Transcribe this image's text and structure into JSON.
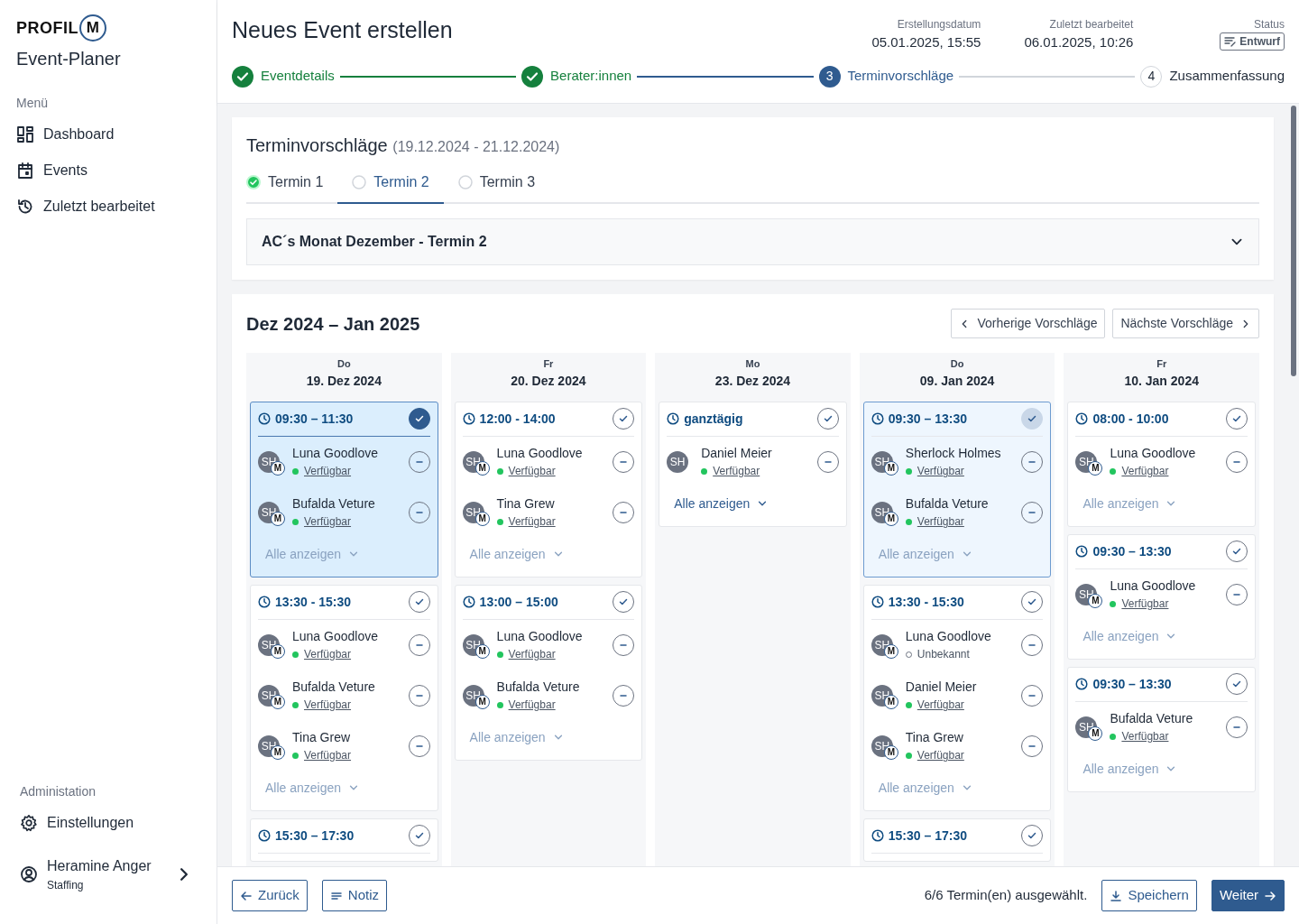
{
  "sidebar": {
    "logo": {
      "word": "PROFIL",
      "letter": "M"
    },
    "app_title": "Event-Planer",
    "menu_label": "Menü",
    "menu": [
      {
        "label": "Dashboard"
      },
      {
        "label": "Events"
      },
      {
        "label": "Zuletzt bearbeitet"
      }
    ],
    "admin_label": "Administation",
    "admin": [
      {
        "label": "Einstellungen"
      }
    ],
    "user": {
      "name": "Heramine Anger",
      "role": "Staffing"
    }
  },
  "header": {
    "title": "Neues Event erstellen",
    "meta": [
      {
        "label": "Erstellungsdatum",
        "value": "05.01.2025, 15:55"
      },
      {
        "label": "Zuletzt bearbeitet",
        "value": "06.01.2025, 10:26"
      }
    ],
    "status": {
      "label": "Status",
      "value": "Entwurf"
    },
    "steps": [
      {
        "label": "Eventdetails",
        "done": true,
        "selected": false
      },
      {
        "label": "Berater:innen",
        "done": true,
        "selected": false
      },
      {
        "number": "3",
        "label": "Terminvorschläge",
        "done": false,
        "selected": true
      },
      {
        "number": "4",
        "label": "Zusammenfassung",
        "done": false,
        "selected": false
      }
    ]
  },
  "proposals": {
    "title": "Terminvorschläge",
    "range": "(19.12.2024 - 21.12.2024)",
    "tabs": [
      {
        "label": "Termin 1",
        "done": true,
        "selected": false
      },
      {
        "label": "Termin 2",
        "done": false,
        "selected": true
      },
      {
        "label": "Termin 3",
        "done": false,
        "selected": false
      }
    ],
    "accordion": {
      "title": "AC´s Monat Dezember - Termin 2",
      "expanded": false
    }
  },
  "calendar": {
    "title": "Dez 2024 – Jan 2025",
    "prev_button": "Vorherige Vorschläge",
    "next_button": "Nächste Vorschläge",
    "days": [
      {
        "weekday": "Do",
        "date": "19. Dez 2024",
        "slots": [
          {
            "time": "09:30 – 11:30",
            "selected": true,
            "highlighted": false,
            "show_all": {
              "label": "Alle anzeigen",
              "enabled": false
            },
            "people": [
              {
                "initials": "SH",
                "badge": "M",
                "name": "Luna Goodlove",
                "status": "Verfügbar",
                "available": true
              },
              {
                "initials": "SH",
                "badge": "M",
                "name": "Bufalda Veture",
                "status": "Verfügbar",
                "available": true
              }
            ]
          },
          {
            "time": "13:30 - 15:30",
            "selected": false,
            "highlighted": false,
            "show_all": {
              "label": "Alle anzeigen",
              "enabled": false
            },
            "people": [
              {
                "initials": "SH",
                "badge": "M",
                "name": "Luna Goodlove",
                "status": "Verfügbar",
                "available": true
              },
              {
                "initials": "SH",
                "badge": "M",
                "name": "Bufalda Veture",
                "status": "Verfügbar",
                "available": true
              },
              {
                "initials": "SH",
                "badge": "M",
                "name": "Tina Grew",
                "status": "Verfügbar",
                "available": true
              }
            ]
          },
          {
            "time": "15:30 – 17:30",
            "selected": false,
            "highlighted": false
          }
        ]
      },
      {
        "weekday": "Fr",
        "date": "20. Dez 2024",
        "slots": [
          {
            "time": "12:00 - 14:00",
            "selected": false,
            "highlighted": false,
            "show_all": {
              "label": "Alle anzeigen",
              "enabled": false
            },
            "people": [
              {
                "initials": "SH",
                "badge": "M",
                "name": "Luna Goodlove",
                "status": "Verfügbar",
                "available": true
              },
              {
                "initials": "SH",
                "badge": "M",
                "name": "Tina Grew",
                "status": "Verfügbar",
                "available": true
              }
            ]
          },
          {
            "time": "13:00 – 15:00",
            "selected": false,
            "highlighted": false,
            "show_all": {
              "label": "Alle anzeigen",
              "enabled": false
            },
            "people": [
              {
                "initials": "SH",
                "badge": "M",
                "name": "Luna Goodlove",
                "status": "Verfügbar",
                "available": true
              },
              {
                "initials": "SH",
                "badge": "M",
                "name": "Bufalda Veture",
                "status": "Verfügbar",
                "available": true
              }
            ]
          }
        ]
      },
      {
        "weekday": "Mo",
        "date": "23. Dez 2024",
        "slots": [
          {
            "time": "ganztägig",
            "selected": false,
            "highlighted": false,
            "show_all": {
              "label": "Alle anzeigen",
              "enabled": true
            },
            "people": [
              {
                "initials": "SH",
                "name": "Daniel Meier",
                "status": "Verfügbar",
                "available": true
              }
            ]
          }
        ]
      },
      {
        "weekday": "Do",
        "date": "09. Jan 2024",
        "slots": [
          {
            "time": "09:30 – 13:30",
            "selected": false,
            "highlighted": true,
            "show_all": {
              "label": "Alle anzeigen",
              "enabled": false
            },
            "people": [
              {
                "initials": "SH",
                "badge": "M",
                "name": "Sherlock Holmes",
                "status": "Verfügbar",
                "available": true
              },
              {
                "initials": "SH",
                "badge": "M",
                "name": "Bufalda Veture",
                "status": "Verfügbar",
                "available": true
              }
            ]
          },
          {
            "time": "13:30 - 15:30",
            "selected": false,
            "highlighted": false,
            "show_all": {
              "label": "Alle anzeigen",
              "enabled": false
            },
            "people": [
              {
                "initials": "SH",
                "badge": "M",
                "name": "Luna Goodlove",
                "status": "Unbekannt",
                "available": false
              },
              {
                "initials": "SH",
                "badge": "M",
                "name": "Daniel Meier",
                "status": "Verfügbar",
                "available": true
              },
              {
                "initials": "SH",
                "badge": "M",
                "name": "Tina Grew",
                "status": "Verfügbar",
                "available": true
              }
            ]
          },
          {
            "time": "15:30 – 17:30",
            "selected": false,
            "highlighted": false
          }
        ]
      },
      {
        "weekday": "Fr",
        "date": "10. Jan 2024",
        "slots": [
          {
            "time": "08:00 - 10:00",
            "selected": false,
            "highlighted": false,
            "show_all": {
              "label": "Alle anzeigen",
              "enabled": false
            },
            "people": [
              {
                "initials": "SH",
                "badge": "M",
                "name": "Luna Goodlove",
                "status": "Verfügbar",
                "available": true
              }
            ]
          },
          {
            "time": "09:30 – 13:30",
            "selected": false,
            "highlighted": false,
            "show_all": {
              "label": "Alle anzeigen",
              "enabled": false
            },
            "people": [
              {
                "initials": "SH",
                "badge": "M",
                "name": "Luna Goodlove",
                "status": "Verfügbar",
                "available": true
              }
            ]
          },
          {
            "time": "09:30 – 13:30",
            "selected": false,
            "highlighted": false,
            "show_all": {
              "label": "Alle anzeigen",
              "enabled": false
            },
            "people": [
              {
                "initials": "SH",
                "badge": "M",
                "name": "Bufalda Veture",
                "status": "Verfügbar",
                "available": true
              }
            ]
          }
        ]
      }
    ]
  },
  "footer": {
    "left_buttons": [
      {
        "label": "Zurück",
        "primary": false
      },
      {
        "label": "Notiz",
        "primary": false
      }
    ],
    "summary": "6/6 Termin(en) ausgewählt.",
    "right_buttons": [
      {
        "label": "Speichern",
        "primary": false
      },
      {
        "label": "Weiter",
        "primary": true
      }
    ]
  }
}
